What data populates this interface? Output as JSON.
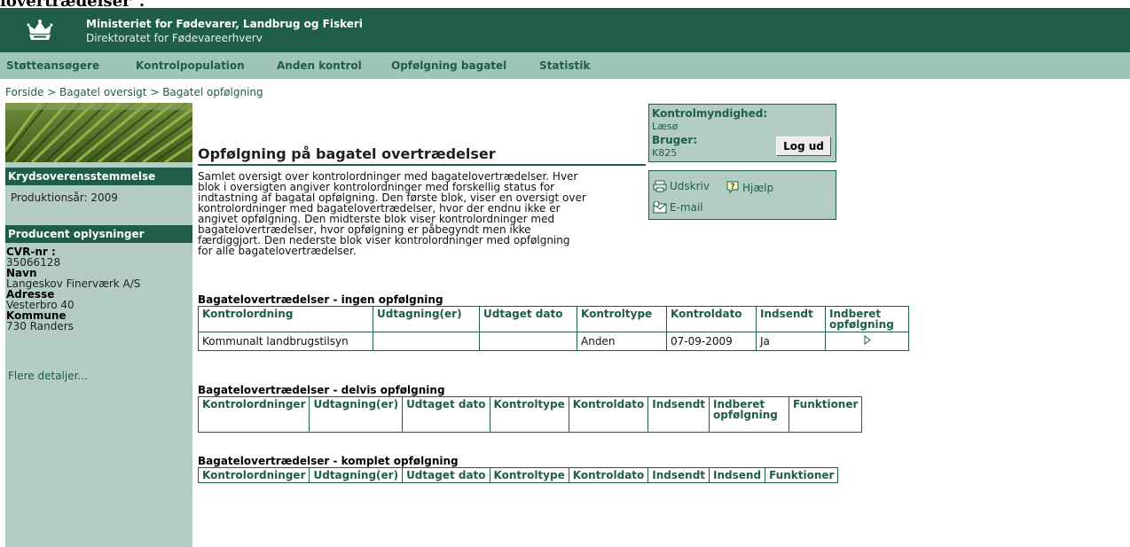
{
  "top_fragment": "lovertrædelser\".",
  "header": {
    "title": "Ministeriet for Fødevarer, Landbrug og Fiskeri",
    "subtitle": "Direktoratet for Fødevareerhverv"
  },
  "nav": [
    "Støtteansøgere",
    "Kontrolpopulation",
    "Anden kontrol",
    "Opfølgning bagatel",
    "Statistik"
  ],
  "breadcrumb": {
    "items": [
      "Forside",
      "Bagatel oversigt",
      "Bagatel opfølgning"
    ],
    "sep": " > "
  },
  "sidebar": {
    "section1_title": "Krydsoverensstemmelse",
    "production_year": "Produktionsår: 2009",
    "section2_title": "Producent oplysninger",
    "cvr_label": "CVR-nr :",
    "cvr_value": "35066128",
    "name_label": "Navn",
    "name_value": "Langeskov Finerværk A/S",
    "address_label": "Adresse",
    "address_value": "Vesterbro 40",
    "municipality_label": "Kommune",
    "municipality_value": "730 Randers",
    "more_link": "Flere detaljer..."
  },
  "main": {
    "title": "Opfølgning på bagatel overtrædelser",
    "intro_lines": [
      "Samlet oversigt over kontrolordninger med bagatelovertrædelser. Hver",
      "blok i oversigten angiver kontrolordninger med forskellig status for",
      "indtastning af bagatal opfølgning. Den første blok, viser en oversigt over",
      "kontrolordninger med bagatelovertrædelser, hvor der endnu ikke er",
      "angivet opfølgning. Den midterste blok viser kontrolordninger med",
      "bagatelovertrædelser, hvor opfølgning er påbegyndt men ikke",
      "færdiggjort. Den nederste blok viser kontrolordninger med opfølgning",
      "for alle bagatelovertrædelser."
    ]
  },
  "infobox": {
    "authority_label": "Kontrolmyndighed:",
    "authority_value": "Læsø",
    "user_label": "Bruger:",
    "user_value": "K825",
    "logout_label": "Log ud"
  },
  "tools": {
    "print": "Udskriv",
    "help": "Hjælp",
    "email": "E-mail"
  },
  "sections": [
    {
      "title": "Bagatelovertrædelser - ingen opfølgning",
      "headers": [
        "Kontrolordning",
        "Udtagning(er)",
        "Udtaget dato",
        "Kontroltype",
        "Kontroldato",
        "Indsendt",
        "Indberet opfølgning"
      ],
      "rows": [
        [
          "Kommunalt landbrugstilsyn",
          "",
          "",
          "Anden",
          "07-09-2009",
          "Ja"
        ]
      ]
    },
    {
      "title": "Bagatelovertrædelser - delvis opfølgning",
      "headers": [
        "Kontrolordninger",
        "Udtagning(er)",
        "Udtaget dato",
        "Kontroltype",
        "Kontroldato",
        "Indsendt",
        "Indberet opfølgning",
        "Funktioner"
      ],
      "rows": []
    },
    {
      "title": "Bagatelovertrædelser - komplet opfølgning",
      "headers": [
        "Kontrolordninger",
        "Udtagning(er)",
        "Udtaget dato",
        "Kontroltype",
        "Kontroldato",
        "Indsendt",
        "Indsend",
        "Funktioner"
      ],
      "rows": []
    }
  ],
  "colors": {
    "brand_dark_green": "#1e5d4a",
    "nav_green": "#9fc4b8",
    "panel_green": "#b3cdc5"
  }
}
